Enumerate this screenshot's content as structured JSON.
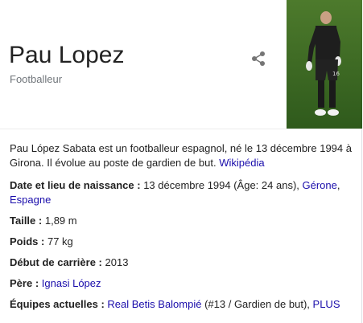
{
  "entity": {
    "name": "Pau Lopez",
    "type": "Footballeur"
  },
  "icons": {
    "share": "share-icon",
    "photo": "player-photo"
  },
  "description": {
    "text": "Pau López Sabata est un footballeur espagnol, né le 13 décembre 1994 à Girona. Il évolue au poste de gardien de but.",
    "source_link": "Wikipédia"
  },
  "facts": {
    "birth": {
      "label": "Date et lieu de naissance",
      "value": "13 décembre 1994 (Âge: 24 ans),",
      "link_city": "Gérone",
      "link_country": "Espagne"
    },
    "height": {
      "label": "Taille",
      "value": "1,89 m"
    },
    "weight": {
      "label": "Poids",
      "value": "77 kg"
    },
    "career_start": {
      "label": "Début de carrière",
      "value": "2013"
    },
    "father": {
      "label": "Père",
      "link": "Ignasi López"
    },
    "teams": {
      "label": "Équipes actuelles",
      "link_team": "Real Betis Balompié",
      "detail": "(#13 / Gardien de but),",
      "link_more": "PLUS"
    }
  },
  "colors": {
    "link": "#1a0dab",
    "text": "#222222",
    "muted": "#70757a",
    "photo_bg": "#3f6b25"
  }
}
